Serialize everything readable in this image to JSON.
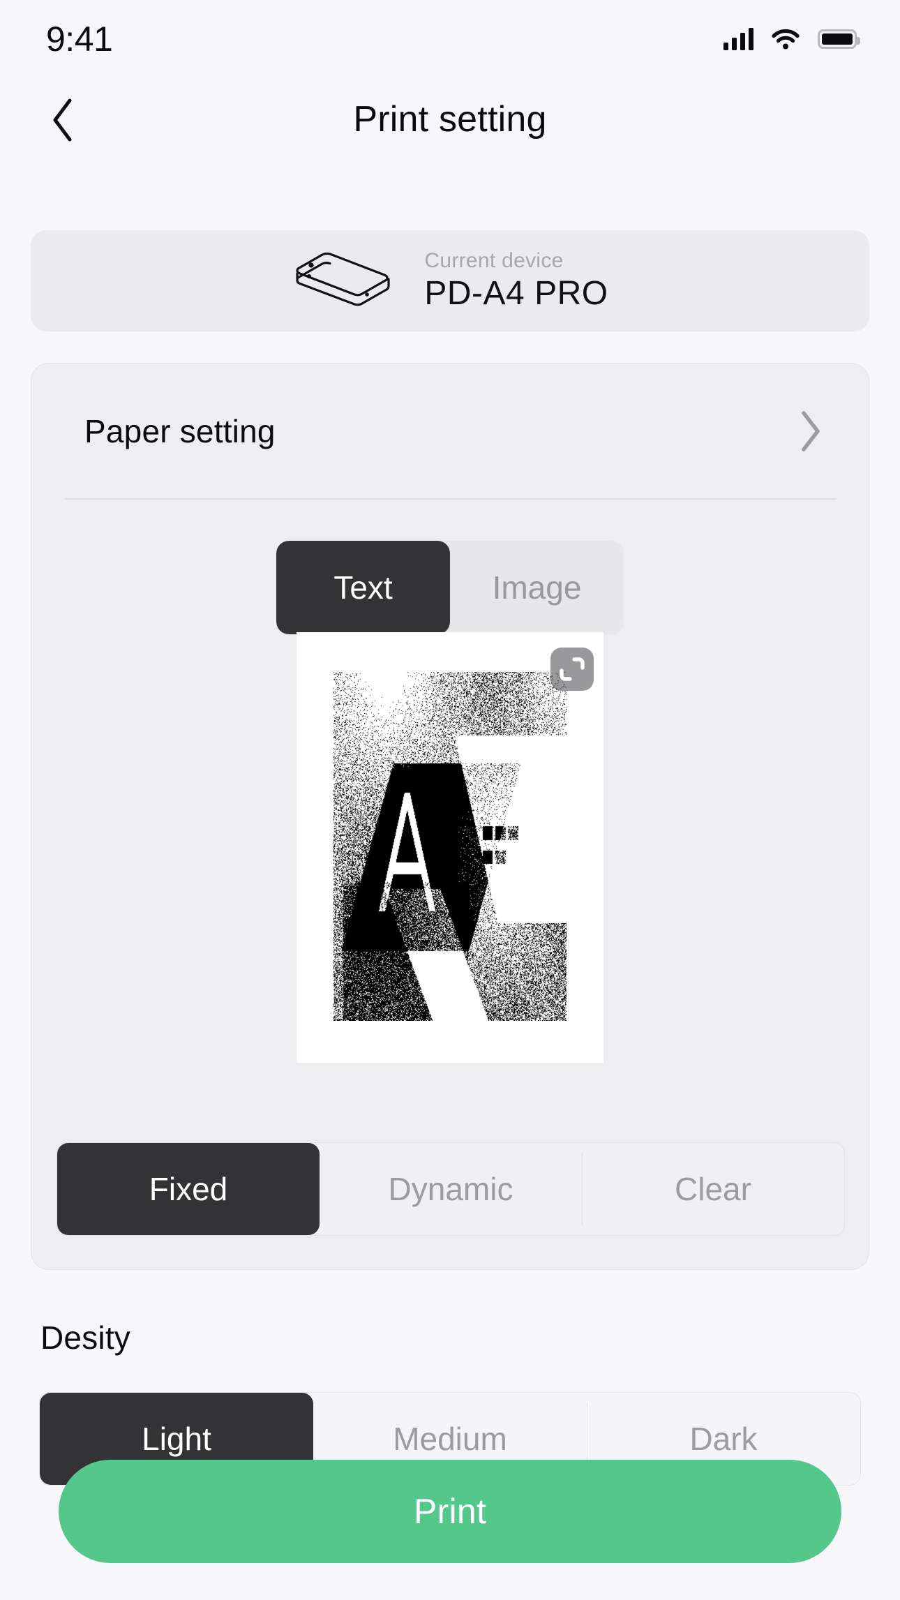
{
  "status_bar": {
    "time": "9:41",
    "icons": [
      "cellular-signal-icon",
      "wifi-icon",
      "battery-icon"
    ]
  },
  "header": {
    "title": "Print setting",
    "back_icon": "chevron-left-icon"
  },
  "device": {
    "label": "Current device",
    "name": "PD-A4 PRO",
    "icon": "printer-device-icon"
  },
  "paper_setting": {
    "label": "Paper setting",
    "chevron_icon": "chevron-right-icon"
  },
  "mode_tabs": [
    {
      "label": "Text",
      "selected": true
    },
    {
      "label": "Image",
      "selected": false
    }
  ],
  "preview": {
    "crop_icon": "crop-icon"
  },
  "dither_tabs": [
    {
      "label": "Fixed",
      "selected": true
    },
    {
      "label": "Dynamic",
      "selected": false
    },
    {
      "label": "Clear",
      "selected": false
    }
  ],
  "density": {
    "title": "Desity",
    "options": [
      {
        "label": "Light",
        "selected": true
      },
      {
        "label": "Medium",
        "selected": false
      },
      {
        "label": "Dark",
        "selected": false
      }
    ]
  },
  "print_button": {
    "label": "Print"
  },
  "colors": {
    "accent_green": "#54c88a",
    "selected_dark": "#333335",
    "page_bg": "#f7f7f9",
    "card_bg": "#eeeef1",
    "muted_text": "#9b9ba1"
  }
}
